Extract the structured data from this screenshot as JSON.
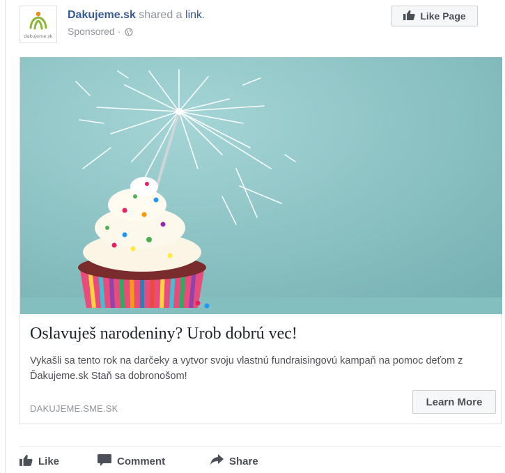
{
  "post": {
    "page_name": "Dakujeme.sk",
    "shared_text": "shared a",
    "link_word": "link",
    "sponsored": "Sponsored",
    "logo_text": "dakujeme.sk"
  },
  "header": {
    "like_page_label": "Like Page"
  },
  "ad": {
    "headline": "Oslavuješ narodeniny? Urob dobrú vec!",
    "description": "Vykašli sa tento rok na darčeky a vytvor svoju vlastnú fundraisingovú kampaň na pomoc deťom z Ďakujeme.sk Staň sa dobronošom!",
    "domain": "DAKUJEME.SME.SK",
    "cta_label": "Learn More"
  },
  "actions": {
    "like": "Like",
    "comment": "Comment",
    "share": "Share"
  },
  "colors": {
    "link": "#365899",
    "meta": "#90949c",
    "image_bg": "#8fc7c8",
    "logo_green": "#8bb838",
    "logo_orange": "#f08c1e"
  }
}
